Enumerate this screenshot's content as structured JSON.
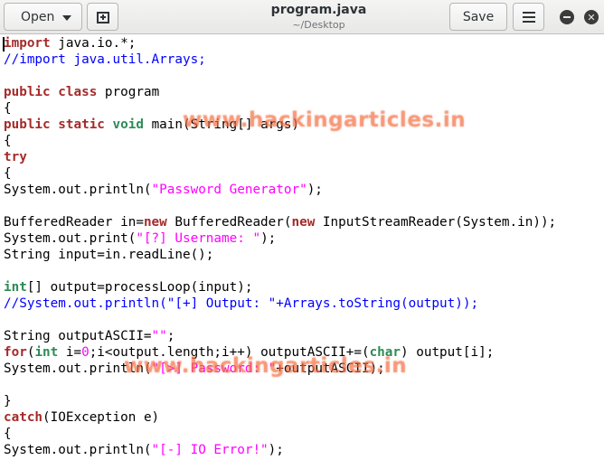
{
  "header": {
    "open_label": "Open",
    "title": "program.java",
    "subtitle": "~/Desktop",
    "save_label": "Save"
  },
  "editor": {
    "lines": [
      [
        [
          "kw",
          "import"
        ],
        [
          "plain",
          " java.io.*;"
        ]
      ],
      [
        [
          "cm",
          "//import java.util.Arrays;"
        ]
      ],
      [],
      [
        [
          "kw",
          "public"
        ],
        [
          "plain",
          " "
        ],
        [
          "kw",
          "class"
        ],
        [
          "plain",
          " program"
        ]
      ],
      [
        [
          "plain",
          "{"
        ]
      ],
      [
        [
          "kw",
          "public"
        ],
        [
          "plain",
          " "
        ],
        [
          "kw",
          "static"
        ],
        [
          "plain",
          " "
        ],
        [
          "type",
          "void"
        ],
        [
          "plain",
          " main(String[] args)"
        ]
      ],
      [
        [
          "plain",
          "{"
        ]
      ],
      [
        [
          "kw",
          "try"
        ]
      ],
      [
        [
          "plain",
          "{"
        ]
      ],
      [
        [
          "plain",
          "System.out.println("
        ],
        [
          "str",
          "\"Password Generator\""
        ],
        [
          "plain",
          ");"
        ]
      ],
      [],
      [
        [
          "plain",
          "BufferedReader in="
        ],
        [
          "kw",
          "new"
        ],
        [
          "plain",
          " BufferedReader("
        ],
        [
          "kw",
          "new"
        ],
        [
          "plain",
          " InputStreamReader(System.in));"
        ]
      ],
      [
        [
          "plain",
          "System.out.print("
        ],
        [
          "str",
          "\"[?] Username: \""
        ],
        [
          "plain",
          ");"
        ]
      ],
      [
        [
          "plain",
          "String input=in.readLine();"
        ]
      ],
      [],
      [
        [
          "type",
          "int"
        ],
        [
          "plain",
          "[] output=processLoop(input);"
        ]
      ],
      [
        [
          "cm",
          "//System.out.println(\"[+] Output: \"+Arrays.toString(output));"
        ]
      ],
      [],
      [
        [
          "plain",
          "String outputASCII="
        ],
        [
          "str",
          "\"\""
        ],
        [
          "plain",
          ";"
        ]
      ],
      [
        [
          "kw",
          "for"
        ],
        [
          "plain",
          "("
        ],
        [
          "type",
          "int"
        ],
        [
          "plain",
          " i="
        ],
        [
          "num",
          "0"
        ],
        [
          "plain",
          ";i<output.length;i++) outputASCII+=("
        ],
        [
          "type",
          "char"
        ],
        [
          "plain",
          ") output[i];"
        ]
      ],
      [
        [
          "plain",
          "System.out.println("
        ],
        [
          "str",
          "\"[>] Password: \""
        ],
        [
          "plain",
          "+outputASCII);"
        ]
      ],
      [],
      [
        [
          "plain",
          "}"
        ]
      ],
      [
        [
          "kw",
          "catch"
        ],
        [
          "plain",
          "(IOException e)"
        ]
      ],
      [
        [
          "plain",
          "{"
        ]
      ],
      [
        [
          "plain",
          "System.out.println("
        ],
        [
          "str",
          "\"[-] IO Error!\""
        ],
        [
          "plain",
          ");"
        ]
      ]
    ]
  },
  "watermark": {
    "text_top": "www.hackingarticles.in",
    "text_bottom": "www.hackingarticles.in"
  },
  "colors": {
    "keyword": "#a52a2a",
    "type": "#2e8b57",
    "string": "#ff00ff",
    "comment": "#0000ff",
    "watermark": "#ff7846"
  },
  "icons": {
    "open_dropdown": "chevron-down-icon",
    "new_document": "new-document-icon",
    "menu": "hamburger-menu-icon",
    "minimize": "minimize-icon",
    "close": "close-icon"
  }
}
